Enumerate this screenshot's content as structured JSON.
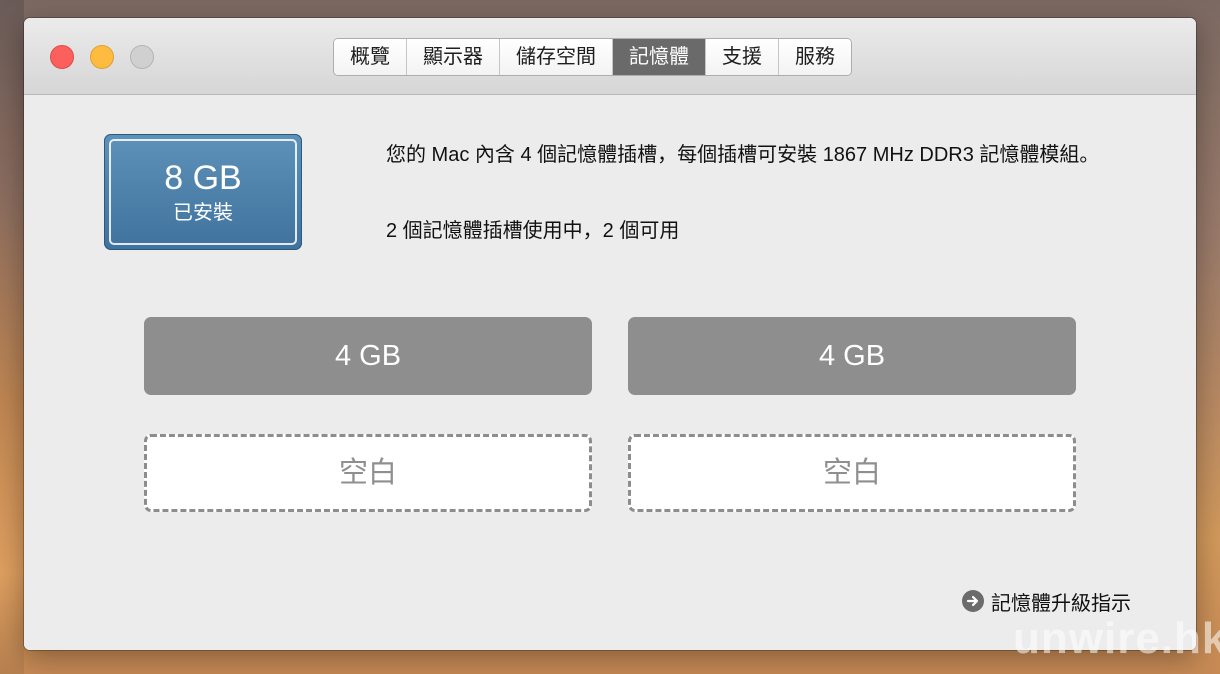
{
  "window": {
    "tabs": [
      {
        "label": "概覽",
        "active": false
      },
      {
        "label": "顯示器",
        "active": false
      },
      {
        "label": "儲存空間",
        "active": false
      },
      {
        "label": "記憶體",
        "active": true
      },
      {
        "label": "支援",
        "active": false
      },
      {
        "label": "服務",
        "active": false
      }
    ]
  },
  "memory": {
    "installed_amount": "8 GB",
    "installed_label": "已安裝",
    "description": "您的 Mac 內含 4 個記憶體插槽，每個插槽可安裝 1867 MHz DDR3 記憶體模組。",
    "slot_status": "2 個記憶體插槽使用中，2 個可用",
    "slots": [
      {
        "label": "4 GB",
        "state": "filled"
      },
      {
        "label": "4 GB",
        "state": "filled"
      },
      {
        "label": "空白",
        "state": "empty"
      },
      {
        "label": "空白",
        "state": "empty"
      }
    ],
    "upgrade_link": "記憶體升級指示"
  },
  "watermark": "unwire.hk",
  "colors": {
    "accent_box": "#4a7ea8",
    "active_tab": "#6a6a6a",
    "filled_slot": "#8e8e8e",
    "close": "#fc605c",
    "minimize": "#fdbc40",
    "zoom": "#d0d0d0"
  }
}
